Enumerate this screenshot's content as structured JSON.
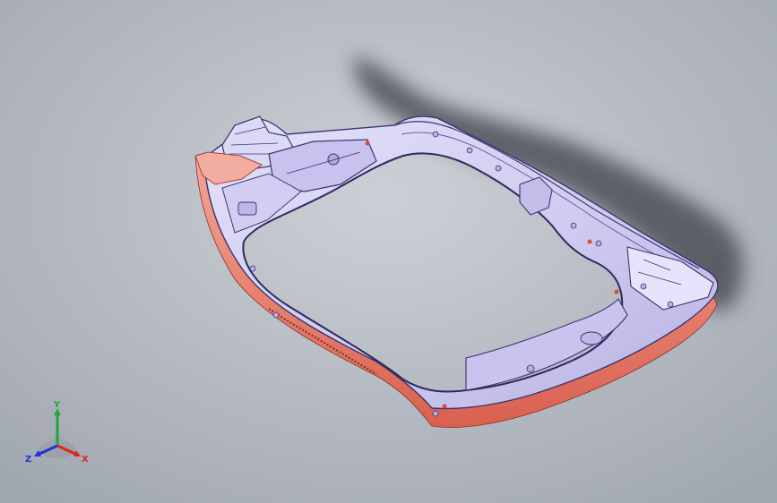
{
  "viewport": {
    "background_colors": [
      "#ccd0d6",
      "#a2a8b1"
    ],
    "model": {
      "part_body_color": "#d6d2f2",
      "part_edge_color": "#3a3670",
      "flange_color": "#f08a78",
      "shadow_color": "#3c4048"
    }
  },
  "triad": {
    "x_label": "X",
    "y_label": "Y",
    "z_label": "Z",
    "x_color": "#e0241c",
    "y_color": "#1ea83c",
    "z_color": "#2232d8"
  }
}
